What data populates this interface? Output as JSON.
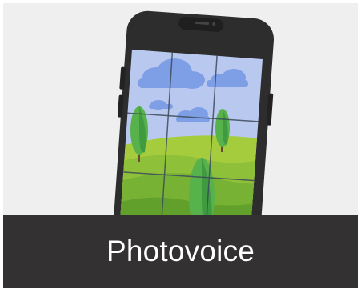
{
  "card": {
    "title": "Photovoice"
  },
  "illustration": {
    "icon": "smartphone-photo-grid-icon",
    "colors": {
      "phone_body": "#2b2b2b",
      "sky": "#b7c7ee",
      "clouds": "#7f9fe6",
      "grass_light": "#a8cd3e",
      "grass_dark": "#6aa62c",
      "tree": "#56b04b",
      "trunk": "#6b4a2f"
    }
  },
  "colors": {
    "card_background": "#efefef",
    "caption_background": "#333131",
    "caption_text": "#ffffff"
  }
}
